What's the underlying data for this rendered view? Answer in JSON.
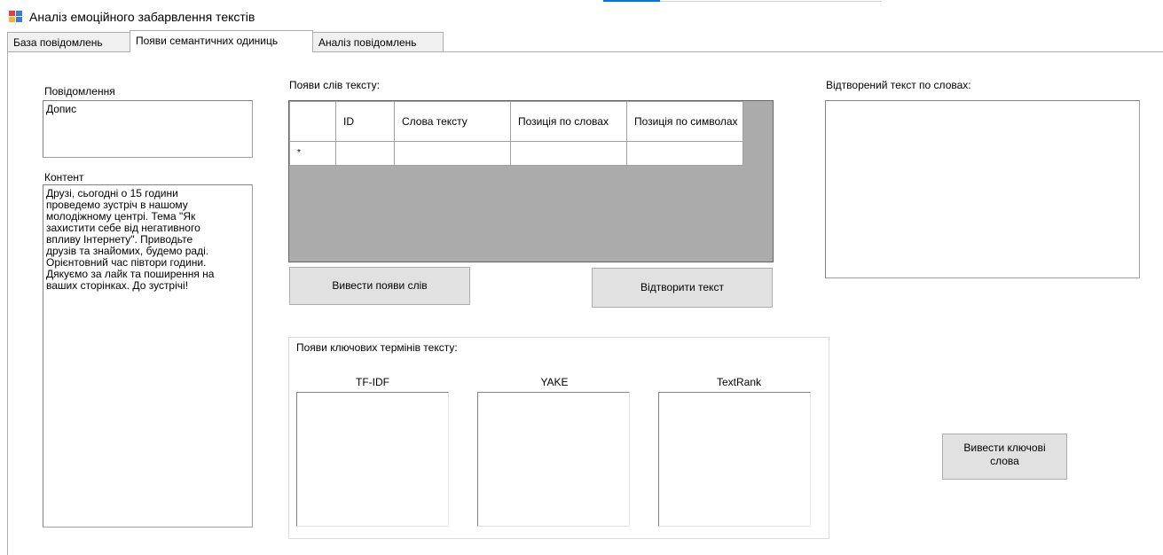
{
  "window": {
    "title": "Аналіз емоційного забарвлення текстів",
    "icon": "app-window-icon",
    "accent_color": "#0078d7"
  },
  "tabs": [
    {
      "label": "База повідомлень",
      "active": false
    },
    {
      "label": "Появи семантичних одиниць",
      "active": true
    },
    {
      "label": "Аналіз повідомлень",
      "active": false
    }
  ],
  "message": {
    "label": "Повідомлення",
    "value": "Допис"
  },
  "content": {
    "label": "Контент",
    "value": "Друзі, сьогодні о 15 години\nпроведемо зустріч в нашому\nмолодіжному центрі. Тема \"Як\nзахистити себе від негативного\nвпливу Інтернету\". Приводьте\nдрузів та знайомих, будемо раді.\nОрієнтовний час півтори години.\nДякуємо за лайк та поширення на\nваших сторінках. До зустрічі!"
  },
  "word_grid": {
    "label": "Появи слів тексту:",
    "columns": [
      "ID",
      "Слова тексту",
      "Позиція по словах",
      "Позиція по символах"
    ],
    "new_row_marker": "*",
    "background_color": "#ababab"
  },
  "buttons": {
    "show_words": "Вивести появи слів",
    "restore_text": "Відтворити текст",
    "show_keywords": "Вивести ключові слова"
  },
  "restored_text": {
    "label": "Відтворений текст по словах:",
    "value": ""
  },
  "keywords": {
    "label": "Появи ключових термінів тексту:",
    "methods": [
      "TF-IDF",
      "YAKE",
      "TextRank"
    ]
  }
}
